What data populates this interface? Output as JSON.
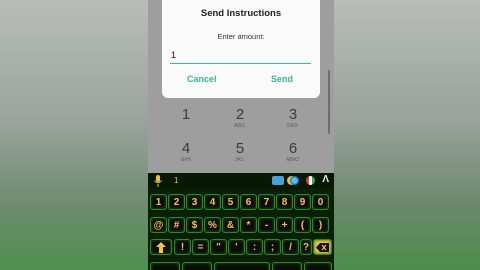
{
  "dialog": {
    "title": "Send Instructions",
    "amount_label": "Enter amount:",
    "amount_value": "1",
    "cancel_label": "Cancel",
    "send_label": "Send"
  },
  "dialpad": {
    "keys": [
      {
        "num": "1",
        "sub": ""
      },
      {
        "num": "2",
        "sub": "ABC"
      },
      {
        "num": "3",
        "sub": "DEF"
      },
      {
        "num": "4",
        "sub": "GHI"
      },
      {
        "num": "5",
        "sub": "JKL"
      },
      {
        "num": "6",
        "sub": "MNO"
      }
    ]
  },
  "keyboard": {
    "typed_text": "1",
    "nav_glyph": "Λ",
    "row1": [
      "1",
      "2",
      "3",
      "4",
      "5",
      "6",
      "7",
      "8",
      "9",
      "0"
    ],
    "row2": [
      "@",
      "#",
      "$",
      "%",
      "&",
      "*",
      "-",
      "+",
      "(",
      ")"
    ],
    "row3": [
      "!",
      "=",
      "\"",
      "'",
      ":",
      ";",
      "/",
      "?"
    ],
    "icons": [
      "mic-icon",
      "clipboard-icon",
      "theme-icon",
      "globe-icon",
      "flag-icon"
    ],
    "colors": {
      "accent": "#f0c83a",
      "key_border": "#2d8a23",
      "background": "#0a1f06"
    }
  },
  "colors": {
    "dialog_accent": "#34b895",
    "dialog_bg": "#fafafa"
  }
}
